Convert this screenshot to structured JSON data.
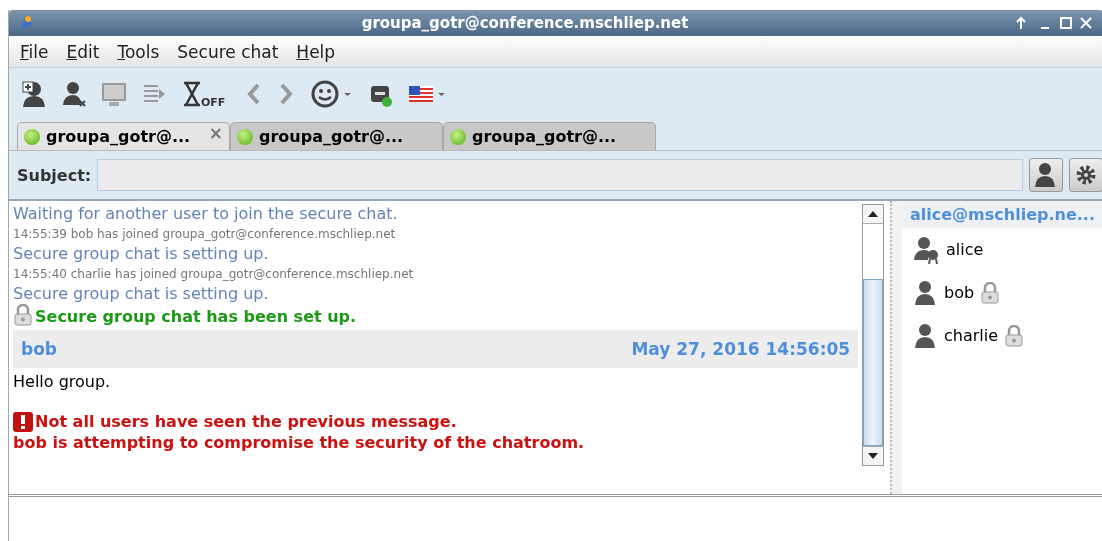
{
  "window": {
    "title": "groupa_gotr@conference.mschliep.net"
  },
  "menu": [
    {
      "label": "File",
      "mnemonic": true
    },
    {
      "label": "Edit",
      "mnemonic": true
    },
    {
      "label": "Tools",
      "mnemonic": true
    },
    {
      "label": "Secure chat",
      "mnemonic": false
    },
    {
      "label": "Help",
      "mnemonic": true
    }
  ],
  "toolbar": {
    "timer_label": "OFF"
  },
  "tabs": [
    {
      "label": "groupa_gotr@...",
      "selected": true,
      "close": "×"
    },
    {
      "label": "groupa_gotr@...",
      "selected": false
    },
    {
      "label": "groupa_gotr@...",
      "selected": false
    }
  ],
  "subject": {
    "label": "Subject:"
  },
  "messages": [
    {
      "kind": "status",
      "text": "Waiting for another user to join the secure chat."
    },
    {
      "kind": "join",
      "text": "14:55:39 bob has joined groupa_gotr@conference.mschliep.net"
    },
    {
      "kind": "status",
      "text": "Secure group chat is setting up."
    },
    {
      "kind": "join",
      "text": "14:55:40 charlie has joined groupa_gotr@conference.mschliep.net"
    },
    {
      "kind": "status",
      "text": "Secure group chat is setting up."
    },
    {
      "kind": "secure",
      "text": "Secure group chat has been set up."
    },
    {
      "kind": "header",
      "sender": "bob",
      "time": "May 27, 2016 14:56:05"
    },
    {
      "kind": "body",
      "text": "Hello group."
    },
    {
      "kind": "warning",
      "lines": [
        "Not all users have seen the previous message.",
        "bob is attempting to compromise the security of the chatroom."
      ]
    }
  ],
  "roster": {
    "header": "alice@mschliep.ne...",
    "members": [
      {
        "name": "alice",
        "kind": "owner",
        "encrypted": false
      },
      {
        "name": "bob",
        "kind": "member",
        "encrypted": true
      },
      {
        "name": "charlie",
        "kind": "member",
        "encrypted": true
      }
    ]
  }
}
